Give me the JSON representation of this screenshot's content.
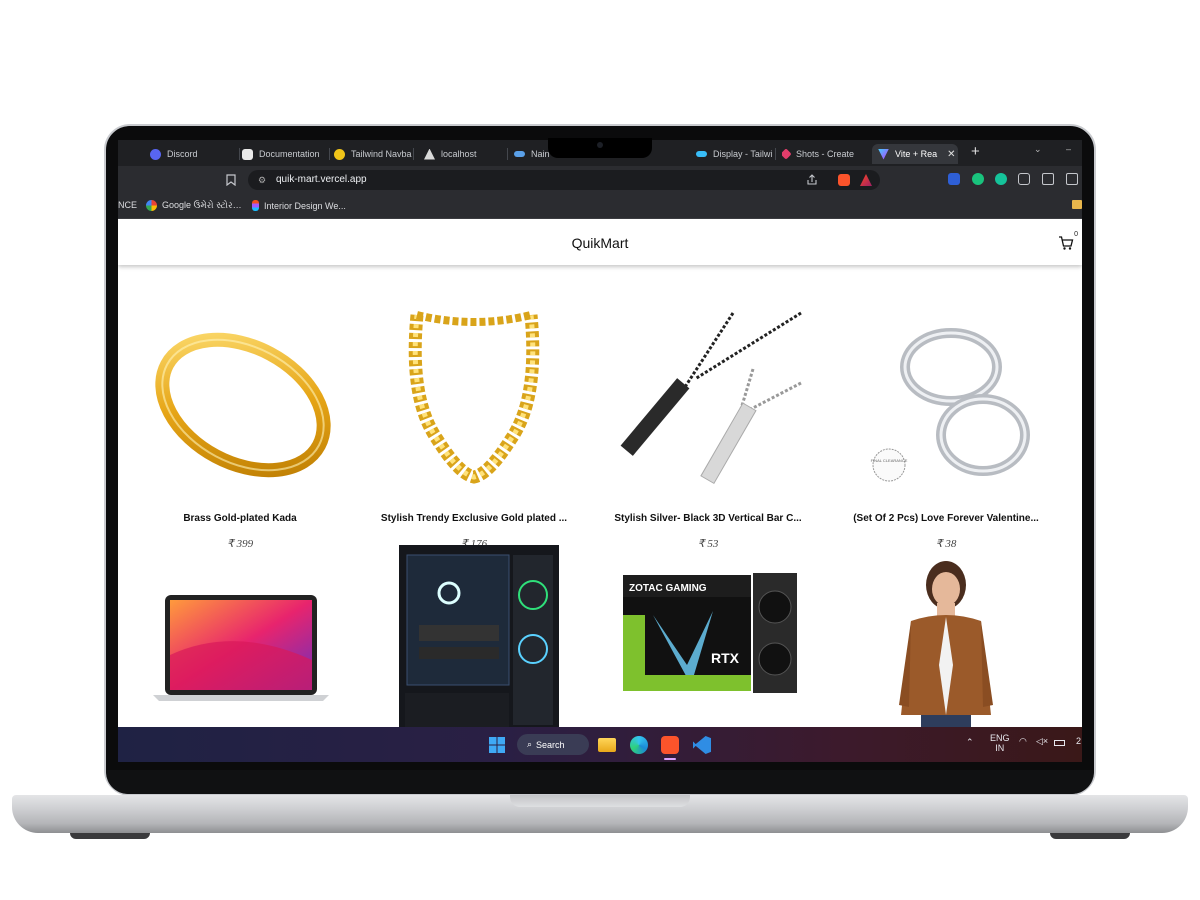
{
  "browser": {
    "tabs": [
      {
        "label": "Discord",
        "icon": "discord-icon",
        "color": "#5865f2"
      },
      {
        "label": "Documentation",
        "icon": "framer-icon",
        "color": "#e9e9e9"
      },
      {
        "label": "Tailwind Navba",
        "icon": "lightbulb-icon",
        "color": "#f0c419"
      },
      {
        "label": "localhost",
        "icon": "triangle-icon",
        "color": "#d9d9d9"
      },
      {
        "label": "Nain",
        "icon": "glasses-icon",
        "color": "#5aa0e8"
      },
      {
        "label": "Display - Tailwi",
        "icon": "tailwind-icon",
        "color": "#38bdf8"
      },
      {
        "label": "Shots - Create",
        "icon": "shots-icon",
        "color": "#e23d6b"
      },
      {
        "label": "Vite + Rea",
        "icon": "vite-icon",
        "color": "#a764ff",
        "active": true
      }
    ],
    "url": "quik-mart.vercel.app",
    "bookmarks": [
      {
        "label": "NCE"
      },
      {
        "label": "Google ઉમેરો સ્ટોર…",
        "icon": "google-icon"
      },
      {
        "label": "Interior Design We...",
        "icon": "figma-icon"
      }
    ]
  },
  "site": {
    "brand": "QuikMart",
    "cart_count": "0"
  },
  "products": [
    {
      "title": "Brass Gold-plated Kada",
      "price": "₹ 399"
    },
    {
      "title": "Stylish Trendy Exclusive Gold plated ...",
      "price": "₹ 176"
    },
    {
      "title": "Stylish Silver- Black 3D Vertical Bar C...",
      "price": "₹ 53"
    },
    {
      "title": "(Set Of 2 Pcs) Love Forever Valentine...",
      "price": "₹ 38"
    },
    {
      "title": "",
      "price": ""
    },
    {
      "title": "",
      "price": ""
    },
    {
      "title": "",
      "price": ""
    },
    {
      "title": "",
      "price": ""
    }
  ],
  "product_badges": {
    "clearance": "FINAL CLEARANCE",
    "gpu_brand": "ZOTAC GAMING",
    "gpu_model": "RTX"
  },
  "taskbar": {
    "search_label": "Search",
    "lang_top": "ENG",
    "lang_bottom": "IN",
    "clock_fragment": "2"
  },
  "colors": {
    "accent_tab": "#35373c",
    "taskbar_left": "#1f2244",
    "taskbar_right": "#3a1818"
  }
}
